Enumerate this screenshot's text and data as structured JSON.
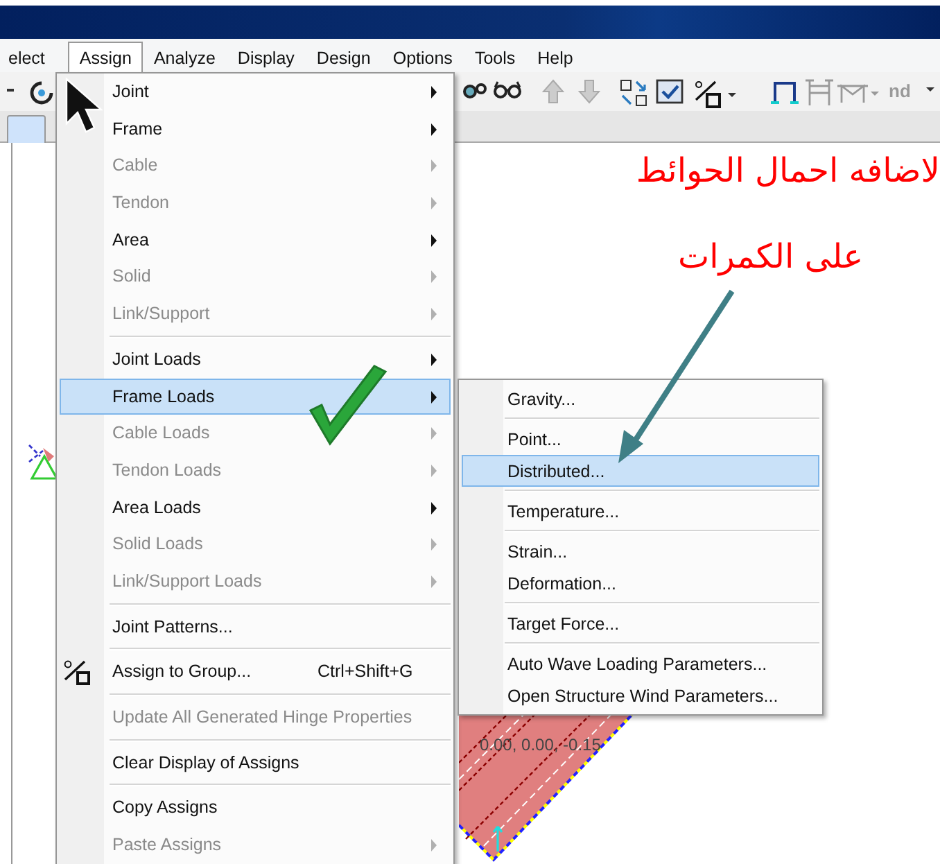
{
  "menu_bar": [
    {
      "label": "elect",
      "selected": false
    },
    {
      "label": "Assign",
      "selected": true
    },
    {
      "label": "Analyze",
      "selected": false
    },
    {
      "label": "Display",
      "selected": false
    },
    {
      "label": "Design",
      "selected": false
    },
    {
      "label": "Options",
      "selected": false
    },
    {
      "label": "Tools",
      "selected": false
    },
    {
      "label": "Help",
      "selected": false
    }
  ],
  "toolbar": {
    "label": "nd"
  },
  "assign_menu": {
    "items": [
      {
        "kind": "item",
        "label": "Joint",
        "disabled": false,
        "submenu": true,
        "selected": false
      },
      {
        "kind": "item",
        "label": "Frame",
        "disabled": false,
        "submenu": true,
        "selected": false
      },
      {
        "kind": "item",
        "label": "Cable",
        "disabled": true,
        "submenu": true,
        "selected": false
      },
      {
        "kind": "item",
        "label": "Tendon",
        "disabled": true,
        "submenu": true,
        "selected": false
      },
      {
        "kind": "item",
        "label": "Area",
        "disabled": false,
        "submenu": true,
        "selected": false
      },
      {
        "kind": "item",
        "label": "Solid",
        "disabled": true,
        "submenu": true,
        "selected": false
      },
      {
        "kind": "item",
        "label": "Link/Support",
        "disabled": true,
        "submenu": true,
        "selected": false
      },
      {
        "kind": "separator"
      },
      {
        "kind": "item",
        "label": "Joint Loads",
        "disabled": false,
        "submenu": true,
        "selected": false
      },
      {
        "kind": "item",
        "label": "Frame Loads",
        "disabled": false,
        "submenu": true,
        "selected": true
      },
      {
        "kind": "item",
        "label": "Cable Loads",
        "disabled": true,
        "submenu": true,
        "selected": false
      },
      {
        "kind": "item",
        "label": "Tendon Loads",
        "disabled": true,
        "submenu": true,
        "selected": false
      },
      {
        "kind": "item",
        "label": "Area Loads",
        "disabled": false,
        "submenu": true,
        "selected": false
      },
      {
        "kind": "item",
        "label": "Solid Loads",
        "disabled": true,
        "submenu": true,
        "selected": false
      },
      {
        "kind": "item",
        "label": "Link/Support Loads",
        "disabled": true,
        "submenu": true,
        "selected": false
      },
      {
        "kind": "separator"
      },
      {
        "kind": "item",
        "label": "Joint Patterns...",
        "disabled": false,
        "submenu": false,
        "selected": false
      },
      {
        "kind": "separator"
      },
      {
        "kind": "item",
        "label": "Assign to Group...",
        "shortcut": "Ctrl+Shift+G",
        "has_icon": true,
        "disabled": false,
        "submenu": false,
        "selected": false
      },
      {
        "kind": "separator"
      },
      {
        "kind": "item",
        "label": "Update All Generated Hinge Properties",
        "disabled": true,
        "submenu": false,
        "selected": false
      },
      {
        "kind": "separator"
      },
      {
        "kind": "item",
        "label": "Clear Display of Assigns",
        "disabled": false,
        "submenu": false,
        "selected": false
      },
      {
        "kind": "separator"
      },
      {
        "kind": "item",
        "label": "Copy Assigns",
        "disabled": false,
        "submenu": false,
        "selected": false
      },
      {
        "kind": "item",
        "label": "Paste Assigns",
        "disabled": true,
        "submenu": true,
        "selected": false
      }
    ]
  },
  "frame_loads_menu": {
    "items": [
      {
        "kind": "item",
        "label": "Gravity...",
        "selected": false
      },
      {
        "kind": "separator"
      },
      {
        "kind": "item",
        "label": "Point...",
        "selected": false
      },
      {
        "kind": "item",
        "label": "Distributed...",
        "selected": true
      },
      {
        "kind": "separator"
      },
      {
        "kind": "item",
        "label": "Temperature...",
        "selected": false
      },
      {
        "kind": "separator"
      },
      {
        "kind": "item",
        "label": "Strain...",
        "selected": false
      },
      {
        "kind": "item",
        "label": "Deformation...",
        "selected": false
      },
      {
        "kind": "separator"
      },
      {
        "kind": "item",
        "label": "Target Force...",
        "selected": false
      },
      {
        "kind": "separator"
      },
      {
        "kind": "item",
        "label": "Auto Wave Loading Parameters...",
        "selected": false
      },
      {
        "kind": "item",
        "label": "Open Structure Wind Parameters...",
        "selected": false
      }
    ]
  },
  "annotation": {
    "line_1": "لاضافه احمال الحوائط",
    "line_2": "على الكمرات"
  },
  "canvas": {
    "coordinate_label": "0.00, 0.00, -0.15"
  }
}
